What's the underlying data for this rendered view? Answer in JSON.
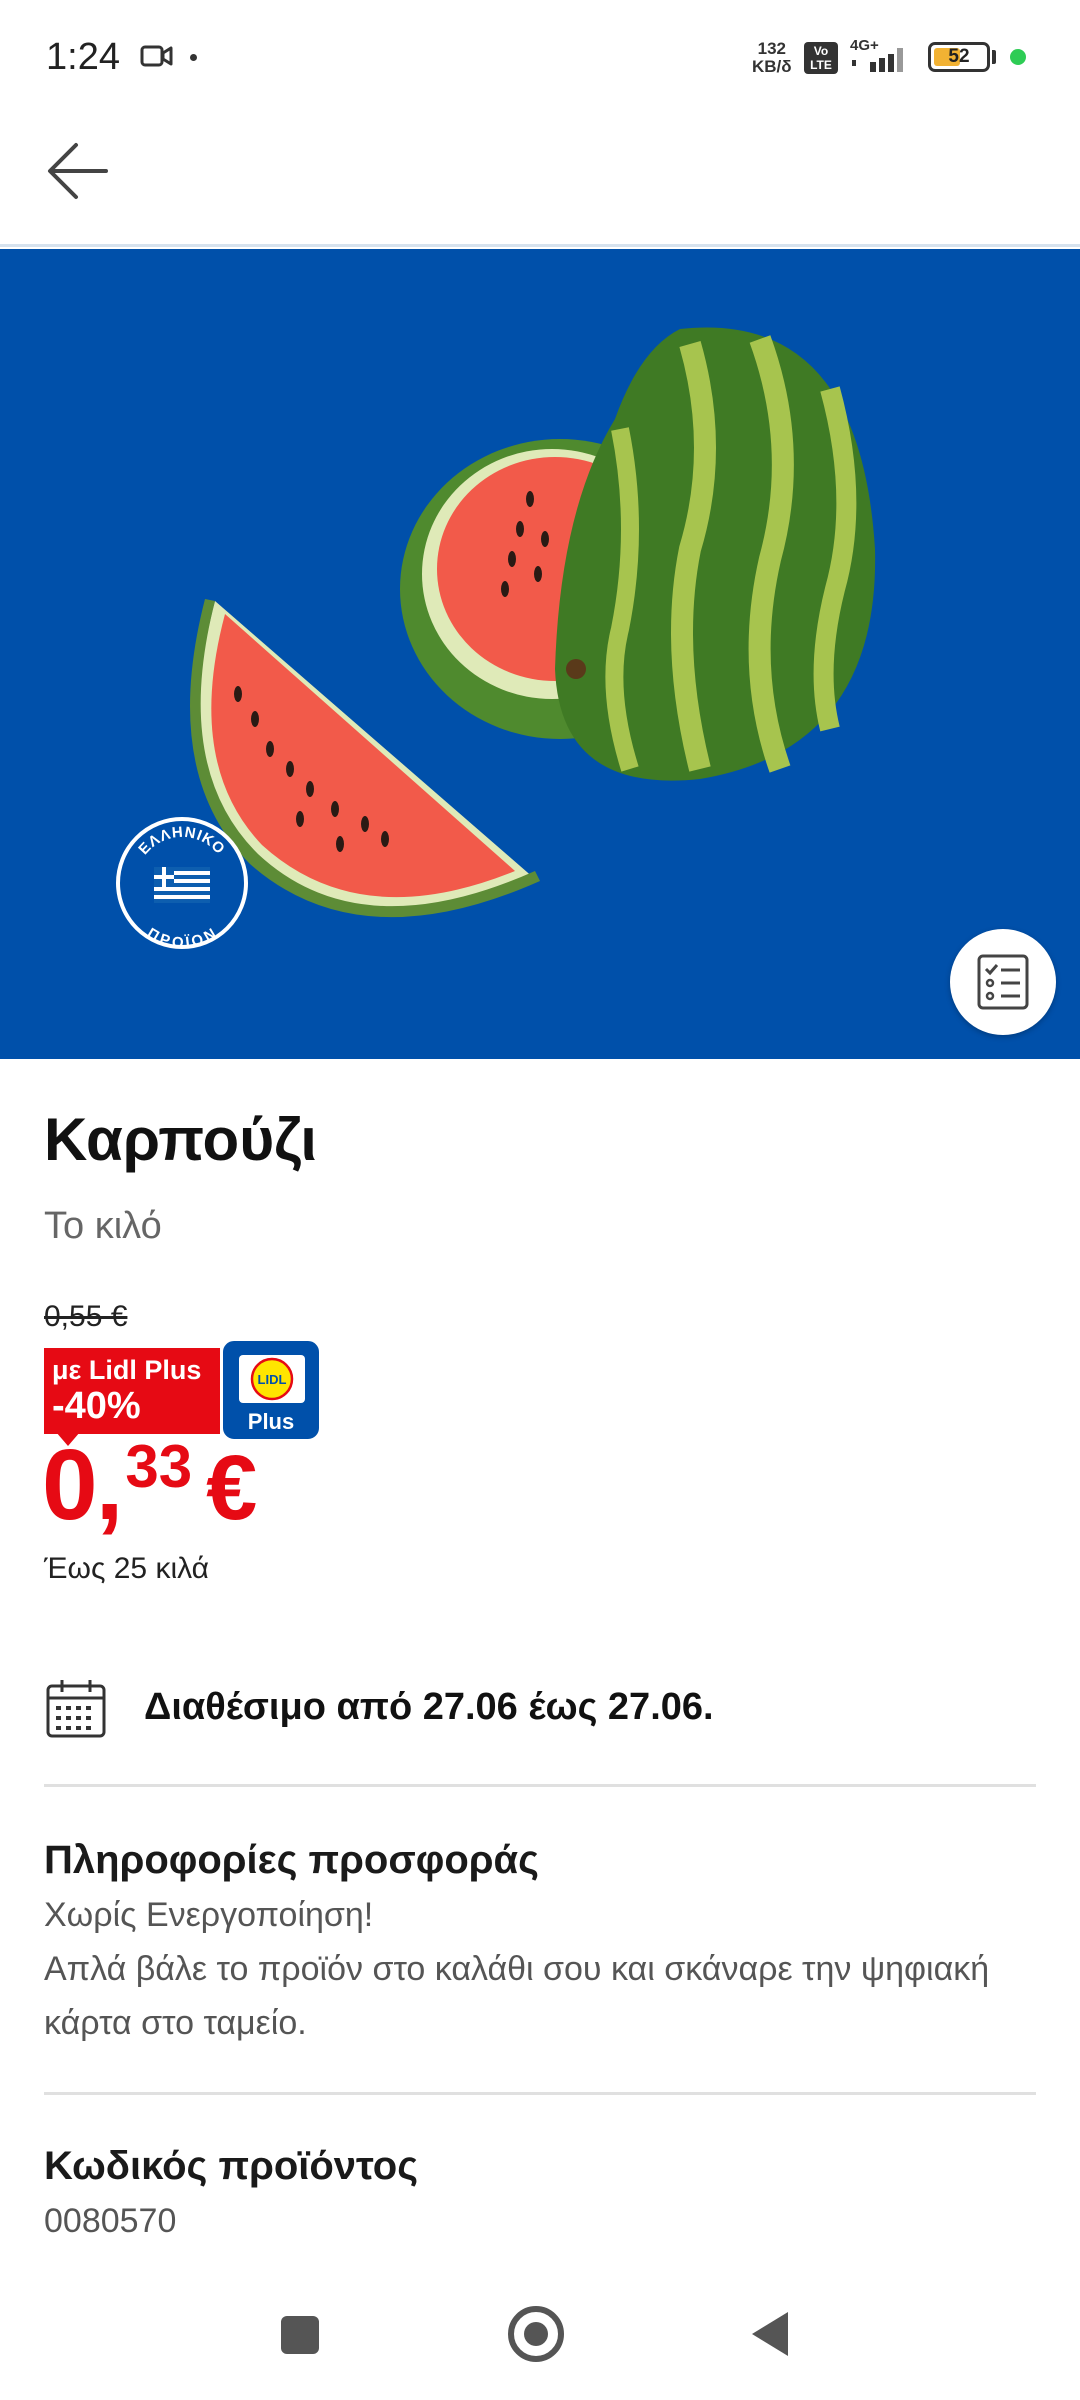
{
  "status_bar": {
    "time": "1:24",
    "net_speed_value": "132",
    "net_speed_unit": "KB/δ",
    "volte": "Vo LTE",
    "network": "4G+",
    "battery": "52",
    "battery_fraction": 0.52
  },
  "app_bar": {
    "back_icon": "arrow-left-icon"
  },
  "hero": {
    "background_color": "#0050aa",
    "badge_text_top": "ΕΛΛΗΝΙΚΟ",
    "badge_text_bottom": "ΠΡΟΪΟΝ",
    "list_icon": "shopping-list-icon"
  },
  "product": {
    "title": "Καρπούζι",
    "unit": "Το κιλό",
    "old_price": "0,55 €",
    "promo_line1": "με Lidl Plus",
    "promo_line2": "-40%",
    "lidl_logo_text": "LIDL",
    "lidl_plus_text": "Plus",
    "price_int": "0,",
    "price_dec": "33",
    "price_currency": "€",
    "limit": "Έως 25 κιλά"
  },
  "availability": {
    "icon": "calendar-icon",
    "text": "Διαθέσιμο από 27.06 έως 27.06."
  },
  "offer_info": {
    "title": "Πληροφορίες προσφοράς",
    "line1": "Χωρίς Ενεργοποίηση!",
    "line2": "Απλά βάλε το προϊόν στο καλάθι σου και σκάναρε την ψηφιακή κάρτα στο ταμείο."
  },
  "product_code": {
    "title": "Κωδικός προϊόντος",
    "value": "0080570"
  },
  "colors": {
    "lidl_blue": "#0050aa",
    "lidl_red": "#e60a14",
    "lidl_yellow": "#ffe500"
  }
}
